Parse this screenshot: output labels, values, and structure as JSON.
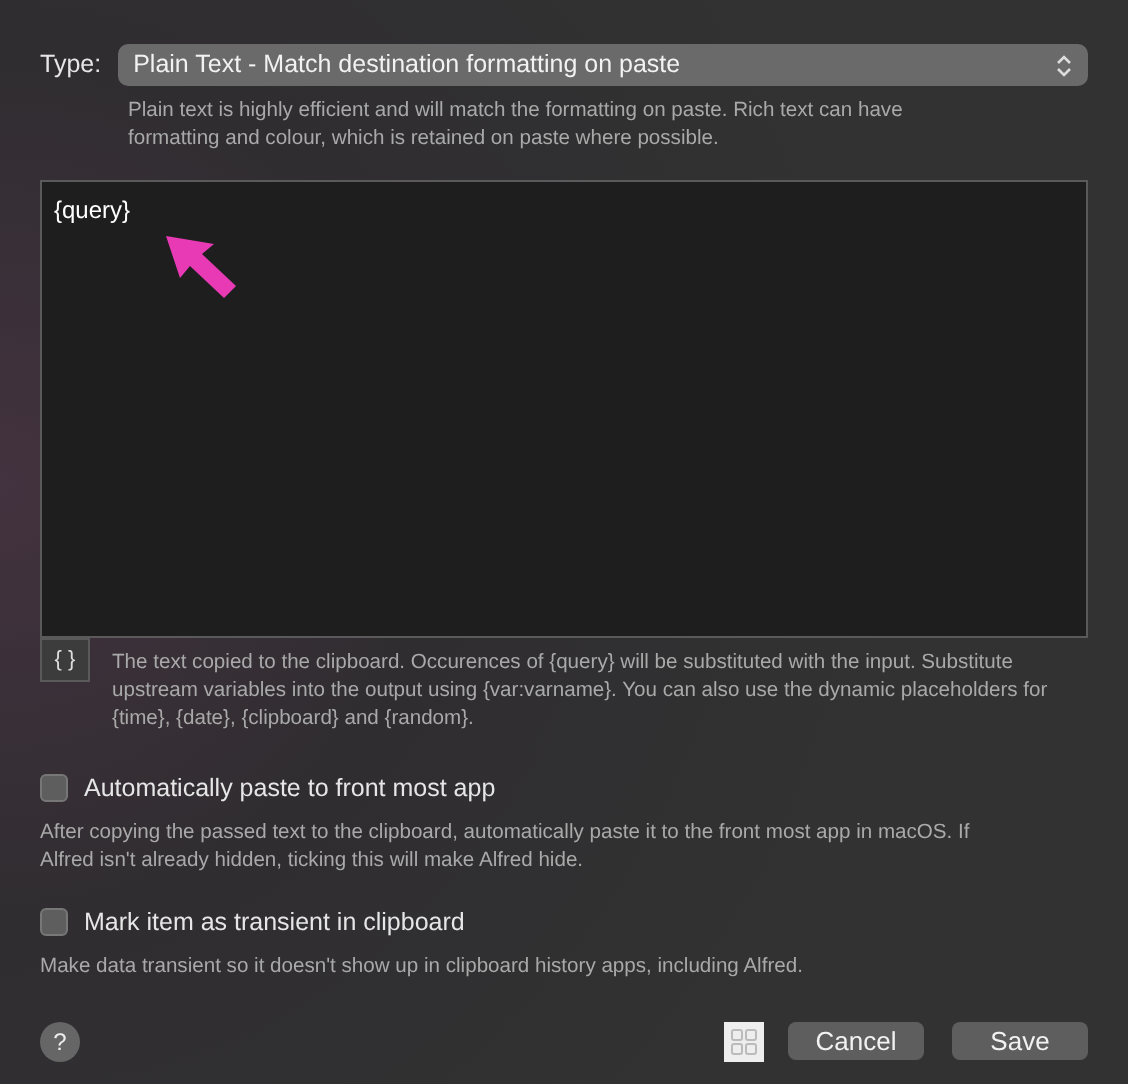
{
  "type_field": {
    "label": "Type:",
    "value": "Plain Text - Match destination formatting on paste"
  },
  "type_help": "Plain text is highly efficient and will match the formatting on paste. Rich text can have formatting and colour, which is retained on paste where possible.",
  "editor": {
    "value": "{query}"
  },
  "placeholder_button": "{ }",
  "editor_help": "The text copied to the clipboard. Occurences of {query} will be substituted with the input. Substitute upstream variables into the output using {var:varname}. You can also use the dynamic placeholders for {time}, {date}, {clipboard} and {random}.",
  "options": [
    {
      "label": "Automatically paste to front most app",
      "checked": false,
      "help": "After copying the passed text to the clipboard, automatically paste it to the front most app in macOS. If Alfred isn't already hidden, ticking this will make Alfred hide."
    },
    {
      "label": "Mark item as transient in clipboard",
      "checked": false,
      "help": "Make data transient so it doesn't show up in clipboard history apps, including Alfred."
    }
  ],
  "help_button": "?",
  "buttons": [
    "Cancel",
    "Save"
  ]
}
